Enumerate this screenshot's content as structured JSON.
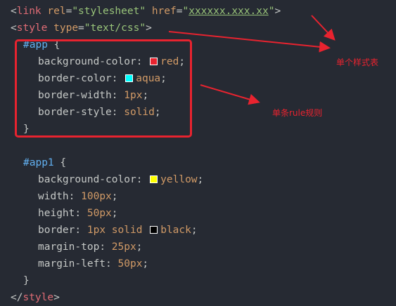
{
  "code": {
    "line1": {
      "open": "<",
      "tag": "link",
      "a1": "rel",
      "eq1": "=",
      "v1": "\"stylesheet\"",
      "a2": "href",
      "eq2": "=",
      "q1": "\"",
      "href": "xxxxxx.xxx.xx",
      "q2": "\"",
      "close": ">"
    },
    "line2": {
      "open": "<",
      "tag": "style",
      "a1": "type",
      "eq1": "=",
      "v1": "\"text/css\"",
      "close": ">"
    },
    "app": {
      "selector": "#app",
      "brace_open": "{",
      "props": [
        {
          "name": "background-color",
          "colon": ":",
          "value": "red",
          "semi": ";",
          "swatch": "#e8232f"
        },
        {
          "name": "border-color",
          "colon": ":",
          "value": "aqua",
          "semi": ";",
          "swatch": "#00ffff"
        },
        {
          "name": "border-width",
          "colon": ":",
          "value": "1px",
          "semi": ";"
        },
        {
          "name": "border-style",
          "colon": ":",
          "value": "solid",
          "semi": ";"
        }
      ],
      "brace_close": "}"
    },
    "app1": {
      "selector": "#app1",
      "brace_open": "{",
      "props": [
        {
          "name": "background-color",
          "colon": ":",
          "value": "yellow",
          "semi": ";",
          "swatch": "#ffff00"
        },
        {
          "name": "width",
          "colon": ":",
          "value": "100px",
          "semi": ";"
        },
        {
          "name": "height",
          "colon": ":",
          "value": "50px",
          "semi": ";"
        },
        {
          "name": "border",
          "colon": ":",
          "value1": "1px",
          "value2": "solid",
          "value3": "black",
          "semi": ";",
          "swatch": "#000000"
        },
        {
          "name": "margin-top",
          "colon": ":",
          "value": "25px",
          "semi": ";"
        },
        {
          "name": "margin-left",
          "colon": ":",
          "value": "50px",
          "semi": ";"
        }
      ],
      "brace_close": "}"
    },
    "last": {
      "open": "</",
      "tag": "style",
      "close": ">"
    }
  },
  "annotations": {
    "stylesheet_label": "单个样式表",
    "rule_label": "单条rule规则"
  },
  "colors": {
    "annotation": "#e8232f",
    "background": "#262a33"
  }
}
